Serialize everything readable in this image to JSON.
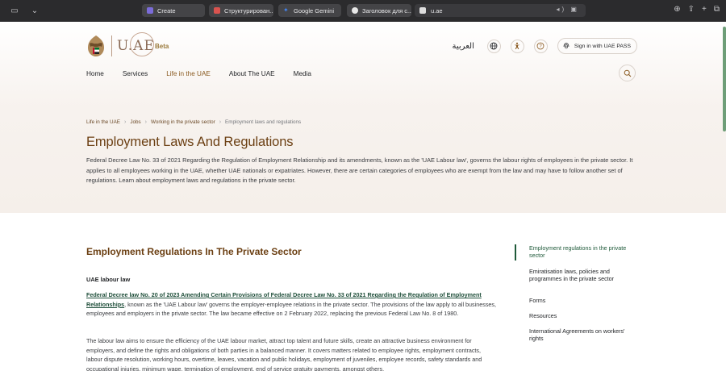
{
  "browser": {
    "tabs": [
      {
        "label": "Create",
        "fav_color": "#7b6cd9"
      },
      {
        "label": "Структурирован...",
        "fav_color": "#d9534f"
      },
      {
        "label": "Google Gemini",
        "fav_color": "#4285f4"
      },
      {
        "label": "Заголовок для с...",
        "fav_color": "#e8e8e8"
      }
    ],
    "url": "u.ae"
  },
  "header": {
    "logo_text": "U.AE",
    "beta": "Beta",
    "arabic": "العربية",
    "signin": "Sign in with UAE PASS"
  },
  "nav": [
    "Home",
    "Services",
    "Life in the UAE",
    "About The UAE",
    "Media"
  ],
  "nav_active": "Life in the UAE",
  "breadcrumb": [
    "Life in the UAE",
    "Jobs",
    "Working in the private sector",
    "Employment laws and regulations"
  ],
  "hero": {
    "title": "Employment Laws And Regulations",
    "intro": "Federal Decree Law No. 33 of 2021 Regarding the Regulation of Employment Relationship and its amendments, known as the 'UAE Labour law', governs the labour rights of employees in the private sector. It applies to all employees working in the UAE, whether UAE nationals or expatriates. However, there are certain categories of employees who are exempt from the law and may have to follow another set of regulations. Learn about employment laws and regulations in the private sector."
  },
  "content": {
    "section_title": "Employment Regulations In The Private Sector",
    "sub_head": "UAE labour law",
    "link_text": "Federal Decree law No. 20 of 2023 Amending Certain Provisions of Federal Decree Law No. 33 of 2021 Regarding the Regulation of Employment Relationships",
    "para1_rest": ", known as the 'UAE Labour law' governs the employer-employee relations in the private sector. The provisions of the law apply to all businesses, employees and employers in the private sector. The law became effective on 2 February 2022, replacing the previous Federal Law No. 8 of 1980.",
    "para2": "The labour law aims to ensure the efficiency of the UAE labour market, attract top talent and future skills, create an attractive business environment for employers, and define the rights and obligations of both parties in a balanced manner. It covers matters related to employee rights, employment contracts, labour dispute resolution, working hours, overtime, leaves, vacation and public holidays, employment of juveniles, employee records, safety standards and occupational injuries, minimum wage, termination of employment, end of service gratuity payments, amongst others."
  },
  "toc": [
    "Employment regulations in the private sector",
    "Emiratisation laws, policies and programmes in the private sector",
    "Forms",
    "Resources",
    "International Agreements on workers' rights"
  ]
}
